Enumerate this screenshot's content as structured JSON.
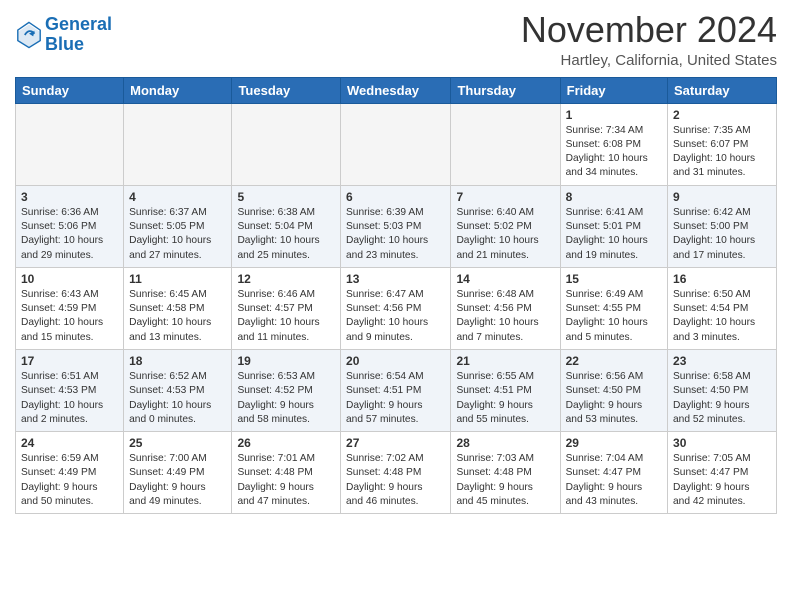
{
  "header": {
    "logo_line1": "General",
    "logo_line2": "Blue",
    "month": "November 2024",
    "location": "Hartley, California, United States"
  },
  "weekdays": [
    "Sunday",
    "Monday",
    "Tuesday",
    "Wednesday",
    "Thursday",
    "Friday",
    "Saturday"
  ],
  "weeks": [
    [
      {
        "day": "",
        "info": ""
      },
      {
        "day": "",
        "info": ""
      },
      {
        "day": "",
        "info": ""
      },
      {
        "day": "",
        "info": ""
      },
      {
        "day": "",
        "info": ""
      },
      {
        "day": "1",
        "info": "Sunrise: 7:34 AM\nSunset: 6:08 PM\nDaylight: 10 hours\nand 34 minutes."
      },
      {
        "day": "2",
        "info": "Sunrise: 7:35 AM\nSunset: 6:07 PM\nDaylight: 10 hours\nand 31 minutes."
      }
    ],
    [
      {
        "day": "3",
        "info": "Sunrise: 6:36 AM\nSunset: 5:06 PM\nDaylight: 10 hours\nand 29 minutes."
      },
      {
        "day": "4",
        "info": "Sunrise: 6:37 AM\nSunset: 5:05 PM\nDaylight: 10 hours\nand 27 minutes."
      },
      {
        "day": "5",
        "info": "Sunrise: 6:38 AM\nSunset: 5:04 PM\nDaylight: 10 hours\nand 25 minutes."
      },
      {
        "day": "6",
        "info": "Sunrise: 6:39 AM\nSunset: 5:03 PM\nDaylight: 10 hours\nand 23 minutes."
      },
      {
        "day": "7",
        "info": "Sunrise: 6:40 AM\nSunset: 5:02 PM\nDaylight: 10 hours\nand 21 minutes."
      },
      {
        "day": "8",
        "info": "Sunrise: 6:41 AM\nSunset: 5:01 PM\nDaylight: 10 hours\nand 19 minutes."
      },
      {
        "day": "9",
        "info": "Sunrise: 6:42 AM\nSunset: 5:00 PM\nDaylight: 10 hours\nand 17 minutes."
      }
    ],
    [
      {
        "day": "10",
        "info": "Sunrise: 6:43 AM\nSunset: 4:59 PM\nDaylight: 10 hours\nand 15 minutes."
      },
      {
        "day": "11",
        "info": "Sunrise: 6:45 AM\nSunset: 4:58 PM\nDaylight: 10 hours\nand 13 minutes."
      },
      {
        "day": "12",
        "info": "Sunrise: 6:46 AM\nSunset: 4:57 PM\nDaylight: 10 hours\nand 11 minutes."
      },
      {
        "day": "13",
        "info": "Sunrise: 6:47 AM\nSunset: 4:56 PM\nDaylight: 10 hours\nand 9 minutes."
      },
      {
        "day": "14",
        "info": "Sunrise: 6:48 AM\nSunset: 4:56 PM\nDaylight: 10 hours\nand 7 minutes."
      },
      {
        "day": "15",
        "info": "Sunrise: 6:49 AM\nSunset: 4:55 PM\nDaylight: 10 hours\nand 5 minutes."
      },
      {
        "day": "16",
        "info": "Sunrise: 6:50 AM\nSunset: 4:54 PM\nDaylight: 10 hours\nand 3 minutes."
      }
    ],
    [
      {
        "day": "17",
        "info": "Sunrise: 6:51 AM\nSunset: 4:53 PM\nDaylight: 10 hours\nand 2 minutes."
      },
      {
        "day": "18",
        "info": "Sunrise: 6:52 AM\nSunset: 4:53 PM\nDaylight: 10 hours\nand 0 minutes."
      },
      {
        "day": "19",
        "info": "Sunrise: 6:53 AM\nSunset: 4:52 PM\nDaylight: 9 hours\nand 58 minutes."
      },
      {
        "day": "20",
        "info": "Sunrise: 6:54 AM\nSunset: 4:51 PM\nDaylight: 9 hours\nand 57 minutes."
      },
      {
        "day": "21",
        "info": "Sunrise: 6:55 AM\nSunset: 4:51 PM\nDaylight: 9 hours\nand 55 minutes."
      },
      {
        "day": "22",
        "info": "Sunrise: 6:56 AM\nSunset: 4:50 PM\nDaylight: 9 hours\nand 53 minutes."
      },
      {
        "day": "23",
        "info": "Sunrise: 6:58 AM\nSunset: 4:50 PM\nDaylight: 9 hours\nand 52 minutes."
      }
    ],
    [
      {
        "day": "24",
        "info": "Sunrise: 6:59 AM\nSunset: 4:49 PM\nDaylight: 9 hours\nand 50 minutes."
      },
      {
        "day": "25",
        "info": "Sunrise: 7:00 AM\nSunset: 4:49 PM\nDaylight: 9 hours\nand 49 minutes."
      },
      {
        "day": "26",
        "info": "Sunrise: 7:01 AM\nSunset: 4:48 PM\nDaylight: 9 hours\nand 47 minutes."
      },
      {
        "day": "27",
        "info": "Sunrise: 7:02 AM\nSunset: 4:48 PM\nDaylight: 9 hours\nand 46 minutes."
      },
      {
        "day": "28",
        "info": "Sunrise: 7:03 AM\nSunset: 4:48 PM\nDaylight: 9 hours\nand 45 minutes."
      },
      {
        "day": "29",
        "info": "Sunrise: 7:04 AM\nSunset: 4:47 PM\nDaylight: 9 hours\nand 43 minutes."
      },
      {
        "day": "30",
        "info": "Sunrise: 7:05 AM\nSunset: 4:47 PM\nDaylight: 9 hours\nand 42 minutes."
      }
    ]
  ]
}
